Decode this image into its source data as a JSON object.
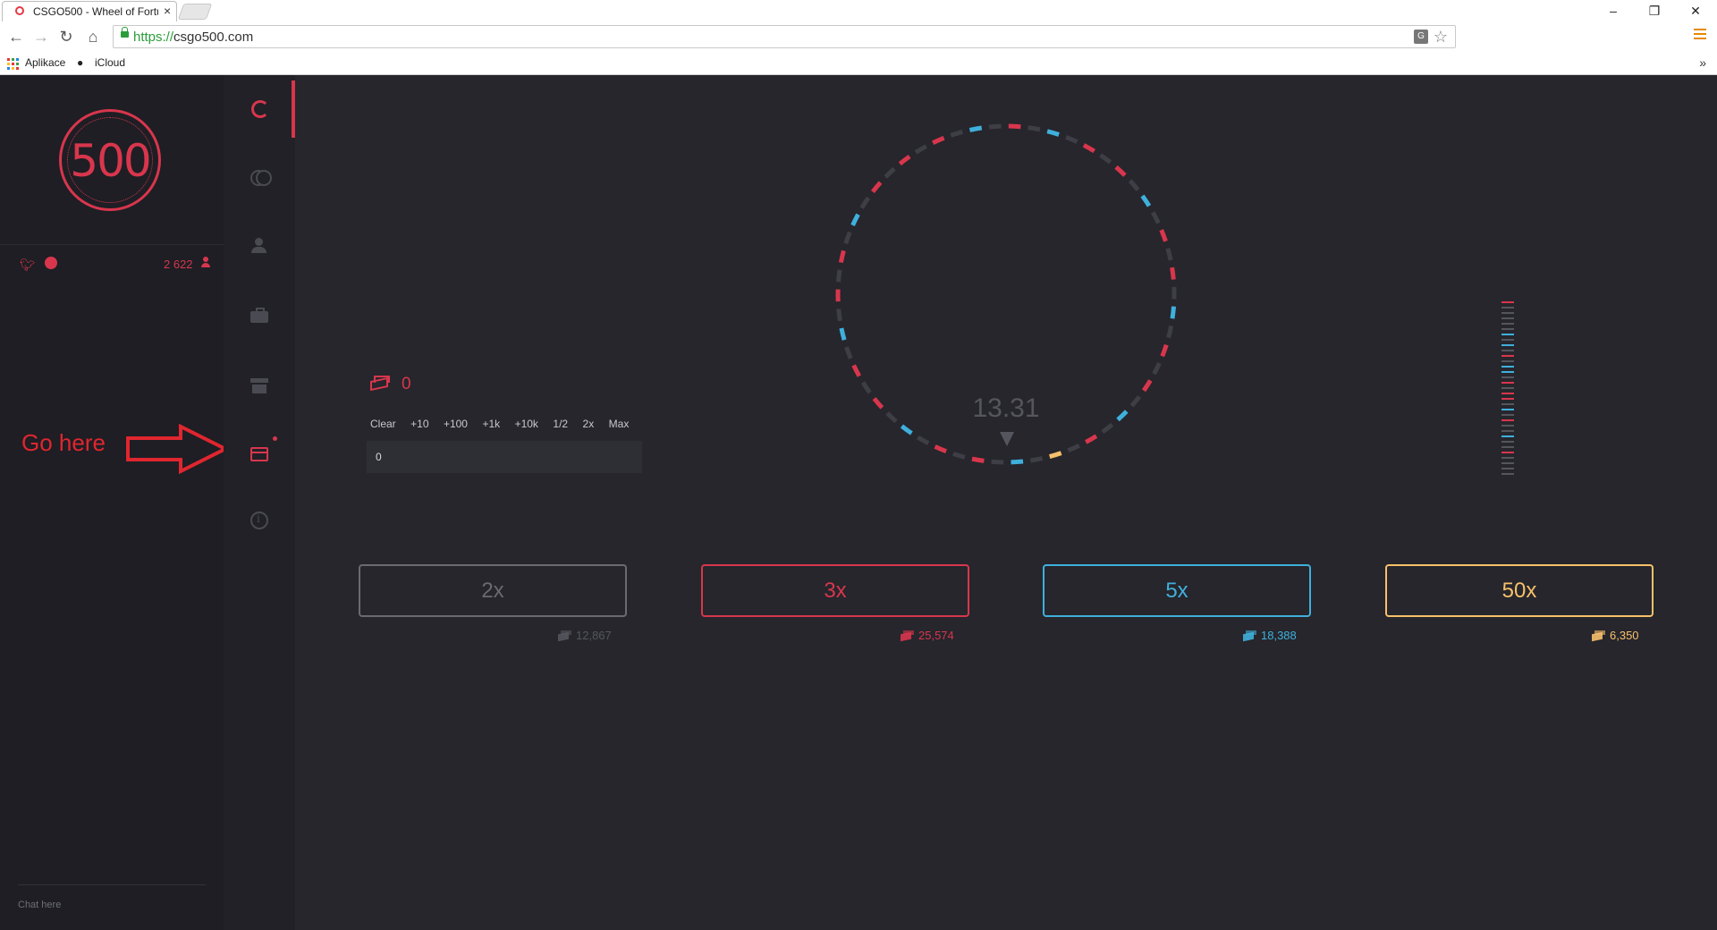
{
  "browser": {
    "tab_title": "CSGO500 - Wheel of Fortu",
    "url_scheme": "https://",
    "url_host": "csgo500.com",
    "bookmarks": [
      "Aplikace",
      "iCloud"
    ],
    "window_controls": [
      "–",
      "❐",
      "✕"
    ]
  },
  "sidebar": {
    "logo_text": "500",
    "online_count": "2 622",
    "chat_placeholder": "Chat here",
    "social_icons": [
      "twitter-icon",
      "steam-icon"
    ]
  },
  "rail": {
    "items": [
      "wheel-icon",
      "coinflip-icon",
      "profile-icon",
      "inventory-icon",
      "shop-icon",
      "gift-icon",
      "info-icon"
    ],
    "active_index": 0
  },
  "annotation": {
    "label": "Go here"
  },
  "bet": {
    "balance": "0",
    "buttons": [
      "Clear",
      "+10",
      "+100",
      "+1k",
      "+10k",
      "1/2",
      "2x",
      "Max"
    ],
    "input_value": "0"
  },
  "wheel": {
    "timer": "13.31"
  },
  "multipliers": [
    {
      "label": "2x",
      "total": "12,867",
      "color": "#6a6a72"
    },
    {
      "label": "3x",
      "total": "25,574",
      "color": "#d8364d"
    },
    {
      "label": "5x",
      "total": "18,388",
      "color": "#3fb0dc"
    },
    {
      "label": "50x",
      "total": "6,350",
      "color": "#f7c06a"
    }
  ],
  "colors": {
    "red": "#d8364d",
    "blue": "#3fb0dc",
    "gray": "#3e3e46",
    "gold": "#f7c06a",
    "annotation_red": "#e0262f"
  }
}
